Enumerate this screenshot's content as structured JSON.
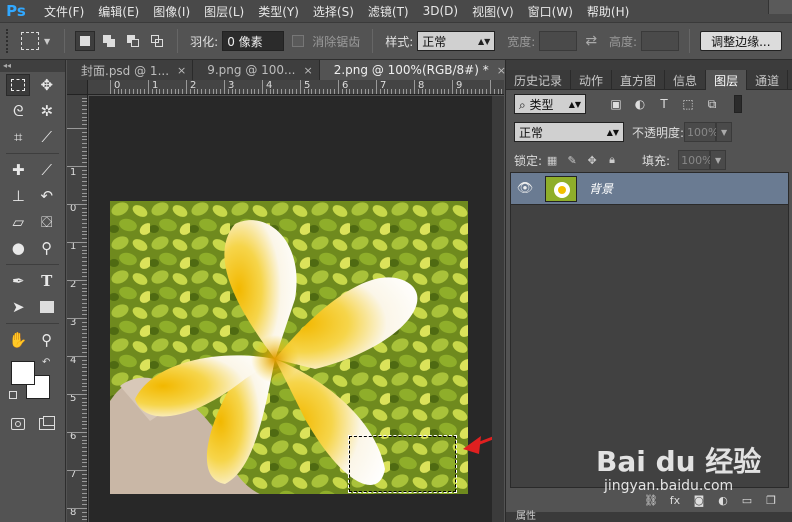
{
  "app": {
    "logo": "Ps",
    "menu": [
      "文件(F)",
      "编辑(E)",
      "图像(I)",
      "图层(L)",
      "类型(Y)",
      "选择(S)",
      "滤镜(T)",
      "3D(D)",
      "视图(V)",
      "窗口(W)",
      "帮助(H)"
    ]
  },
  "options": {
    "feather_label": "羽化:",
    "feather_value": "0 像素",
    "antialias_label": "消除锯齿",
    "style_label": "样式:",
    "style_value": "正常",
    "width_label": "宽度:",
    "height_label": "高度:",
    "refine_edge_label": "调整边缘..."
  },
  "tabs": [
    {
      "label": "封面.psd @ 1...",
      "close": "×"
    },
    {
      "label": "9.png @ 100...",
      "close": "×"
    },
    {
      "label": "2.png @ 100%(RGB/8#) *",
      "close": "×"
    }
  ],
  "rulers": {
    "h_labels": [
      "0",
      "1",
      "2",
      "3",
      "4",
      "5",
      "6",
      "7",
      "8",
      "9"
    ],
    "v_labels": [
      "1",
      "2",
      "3",
      "4",
      "5",
      "6",
      "7",
      "8"
    ],
    "v_zero": "0",
    "v_neg": "1"
  },
  "panel": {
    "tabs": [
      "历史记录",
      "动作",
      "直方图",
      "信息",
      "图层",
      "通道"
    ],
    "filter_label": "类型",
    "blend_mode": "正常",
    "opacity_label": "不透明度:",
    "opacity_value": "100%",
    "lock_label": "锁定:",
    "fill_label": "填充:",
    "fill_value": "100%",
    "layer_name": "背景",
    "bottom_tab": "属性"
  },
  "watermark": {
    "brand": "Bai du 经验",
    "url": "jingyan.baidu.com"
  },
  "colors": {
    "accent_arrow": "#e02020",
    "layer_selected": "#6a7b92",
    "ps_blue": "#31a8ff"
  }
}
